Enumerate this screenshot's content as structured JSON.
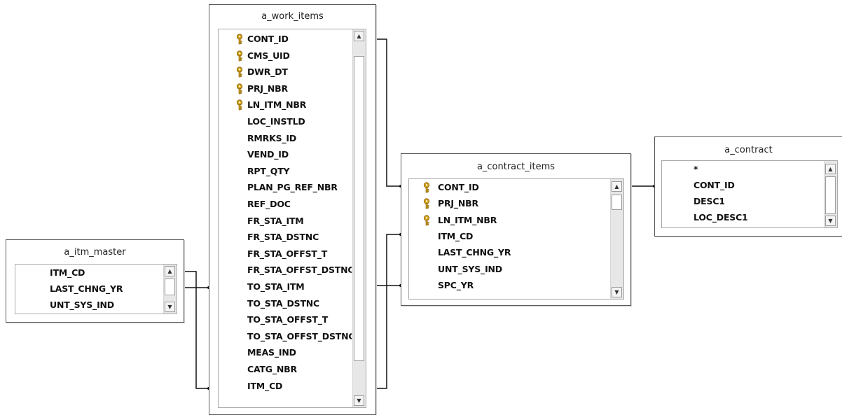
{
  "tables": {
    "work_items": {
      "title": "a_work_items",
      "rows": [
        {
          "label": "CONT_ID",
          "key": true
        },
        {
          "label": "CMS_UID",
          "key": true
        },
        {
          "label": "DWR_DT",
          "key": true
        },
        {
          "label": "PRJ_NBR",
          "key": true
        },
        {
          "label": "LN_ITM_NBR",
          "key": true
        },
        {
          "label": "LOC_INSTLD",
          "key": false
        },
        {
          "label": "RMRKS_ID",
          "key": false
        },
        {
          "label": "VEND_ID",
          "key": false
        },
        {
          "label": "RPT_QTY",
          "key": false
        },
        {
          "label": "PLAN_PG_REF_NBR",
          "key": false
        },
        {
          "label": "REF_DOC",
          "key": false
        },
        {
          "label": "FR_STA_ITM",
          "key": false
        },
        {
          "label": "FR_STA_DSTNC",
          "key": false
        },
        {
          "label": "FR_STA_OFFST_T",
          "key": false
        },
        {
          "label": "FR_STA_OFFST_DSTNC",
          "key": false
        },
        {
          "label": "TO_STA_ITM",
          "key": false
        },
        {
          "label": "TO_STA_DSTNC",
          "key": false
        },
        {
          "label": "TO_STA_OFFST_T",
          "key": false
        },
        {
          "label": "TO_STA_OFFST_DSTNC",
          "key": false
        },
        {
          "label": "MEAS_IND",
          "key": false
        },
        {
          "label": "CATG_NBR",
          "key": false
        },
        {
          "label": "ITM_CD",
          "key": false
        }
      ]
    },
    "itm_master": {
      "title": "a_itm_master",
      "rows": [
        {
          "label": "ITM_CD",
          "key": false
        },
        {
          "label": "LAST_CHNG_YR",
          "key": false
        },
        {
          "label": "UNT_SYS_IND",
          "key": false
        }
      ]
    },
    "contract_items": {
      "title": "a_contract_items",
      "rows": [
        {
          "label": "CONT_ID",
          "key": true
        },
        {
          "label": "PRJ_NBR",
          "key": true
        },
        {
          "label": "LN_ITM_NBR",
          "key": true
        },
        {
          "label": "ITM_CD",
          "key": false
        },
        {
          "label": "LAST_CHNG_YR",
          "key": false
        },
        {
          "label": "UNT_SYS_IND",
          "key": false
        },
        {
          "label": "SPC_YR",
          "key": false
        }
      ]
    },
    "contract": {
      "title": "a_contract",
      "all_columns": "*",
      "rows": [
        {
          "label": "CONT_ID",
          "key": false
        },
        {
          "label": "DESC1",
          "key": false
        },
        {
          "label": "LOC_DESC1",
          "key": false
        }
      ]
    }
  },
  "icons": {
    "key": "key-icon",
    "scroll_up": "scroll-up-arrow",
    "scroll_down": "scroll-down-arrow"
  },
  "colors": {
    "key_gold": "#c99a1c",
    "border": "#5a5a5a",
    "scrollbar": "#e7e7e7"
  }
}
